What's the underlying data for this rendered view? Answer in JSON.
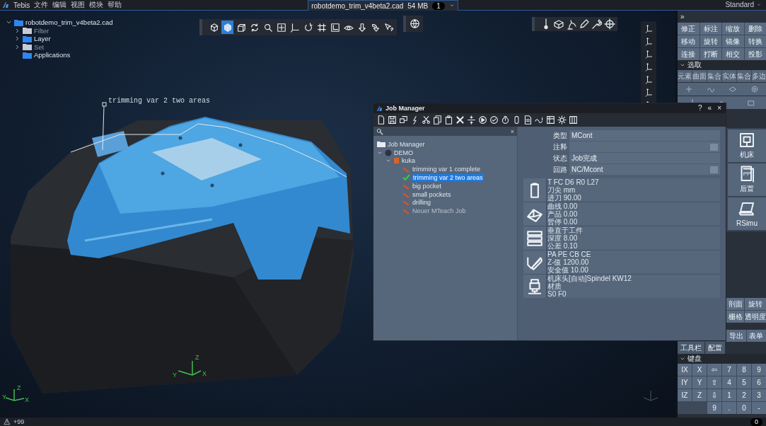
{
  "menu_bar": {
    "app_name": "Tebis",
    "menus": [
      "文件",
      "编辑",
      "视图",
      "模块",
      "帮助"
    ],
    "document_tab": {
      "title": "robotdemo_trim_v4beta2.cad",
      "size": "54 MB",
      "badge": "1"
    },
    "layout": "Standard"
  },
  "scene_tree": {
    "label": "robotdemo_trim_v4beta2.cad",
    "expanded": true,
    "children": [
      {
        "label": "Filter",
        "kind": "group",
        "disabled": true
      },
      {
        "label": "Layer",
        "kind": "group",
        "disabled": false
      },
      {
        "label": "Set",
        "kind": "group",
        "disabled": true
      },
      {
        "label": "Applications",
        "kind": "item",
        "disabled": false
      }
    ]
  },
  "view_toolbar": [
    {
      "selected": false
    },
    {
      "selected": true
    },
    {
      "selected": false
    },
    {
      "selected": false
    },
    {
      "selected": false
    },
    {
      "selected": false
    },
    {
      "selected": false
    },
    {
      "selected": false
    },
    {
      "selected": false
    },
    {
      "selected": false
    },
    {
      "selected": false
    },
    {
      "selected": false
    },
    {
      "selected": false
    },
    {
      "selected": false
    }
  ],
  "viewport": {
    "annotation": "trimming var 2 two areas",
    "axis_triads": [
      {
        "x": "X",
        "y": "Y",
        "z": "Z"
      },
      {
        "x": "X",
        "y": "Y",
        "z": "Z"
      }
    ]
  },
  "job_manager": {
    "title": "Job Manager",
    "window_buttons": [
      "?",
      "«",
      "×"
    ],
    "clear_search": "×",
    "tree": {
      "label": "Job Manager",
      "children": [
        {
          "label": "DEMO",
          "expanded": true,
          "children": [
            {
              "label": "kuka",
              "expanded": true,
              "children": [
                {
                  "label": "trimming var 1 complete",
                  "selected": false,
                  "checked": false,
                  "disabled": false
                },
                {
                  "label": "trimming var 2 two areas",
                  "selected": true,
                  "checked": true,
                  "disabled": false
                },
                {
                  "label": "big pocket",
                  "selected": false,
                  "checked": false,
                  "disabled": false
                },
                {
                  "label": "small pockets",
                  "selected": false,
                  "checked": false,
                  "disabled": false
                },
                {
                  "label": "drilling",
                  "selected": false,
                  "checked": false,
                  "disabled": false
                },
                {
                  "label": "Neuer MTeach Job",
                  "selected": false,
                  "checked": false,
                  "disabled": true
                }
              ]
            }
          ]
        }
      ]
    },
    "properties": [
      {
        "label": "类型",
        "value": "MCont",
        "button": false
      },
      {
        "label": "注释",
        "button": true
      },
      {
        "label": "状态",
        "value": "Job完成",
        "button": false
      },
      {
        "label": "回路",
        "value": "NC/Mcont",
        "button": true
      }
    ],
    "info_rows": [
      {
        "lines": [
          "T FC D6 R0 L27",
          "刀尖 mm",
          "进刀 90.00"
        ]
      },
      {
        "lines": [
          "曲线 0.00",
          "产品 0.00",
          "暂停 0.00"
        ]
      },
      {
        "lines": [
          "垂直于工件",
          "深度 8.00",
          "公差 0.10"
        ]
      },
      {
        "lines": [
          "PA PE CB CE",
          "Z-值 1200.00",
          "安全值 10.00"
        ]
      },
      {
        "lines": [
          "机床头[自动]Spindel KW12",
          "材质",
          "S0 F0"
        ]
      }
    ]
  },
  "right_panel": {
    "collapse": "»",
    "edit_buttons": [
      "修正",
      "标注",
      "缩放",
      "删除",
      "移动",
      "旋转",
      "镜像",
      "转换",
      "连接",
      "打断",
      "相交",
      "投影"
    ],
    "selection": {
      "title": "选取",
      "filters": [
        "元素",
        "曲面",
        "集合",
        "实体",
        "集合",
        "多边"
      ]
    },
    "modules": [
      {
        "label": "机床"
      },
      {
        "label": "后置",
        "badge": "PP"
      },
      {
        "label": "RSimu"
      }
    ],
    "view_buttons": [
      "剖面",
      "旋转",
      "栅格",
      "透明度"
    ],
    "output_buttons": [
      "导出",
      "表单"
    ],
    "tabs": [
      "工具栏",
      "配置"
    ],
    "keyboard": {
      "title": "键盘",
      "rows": [
        [
          "IX",
          "X",
          "⇦",
          "7",
          "8",
          "9"
        ],
        [
          "IY",
          "Y",
          "⇧",
          "4",
          "5",
          "6"
        ],
        [
          "IZ",
          "Z",
          "⇩",
          "1",
          "2",
          "3"
        ],
        [
          "",
          "",
          "9",
          ".",
          "0",
          "-"
        ]
      ]
    }
  },
  "status_bar": {
    "message": "+99",
    "badge": "0"
  }
}
